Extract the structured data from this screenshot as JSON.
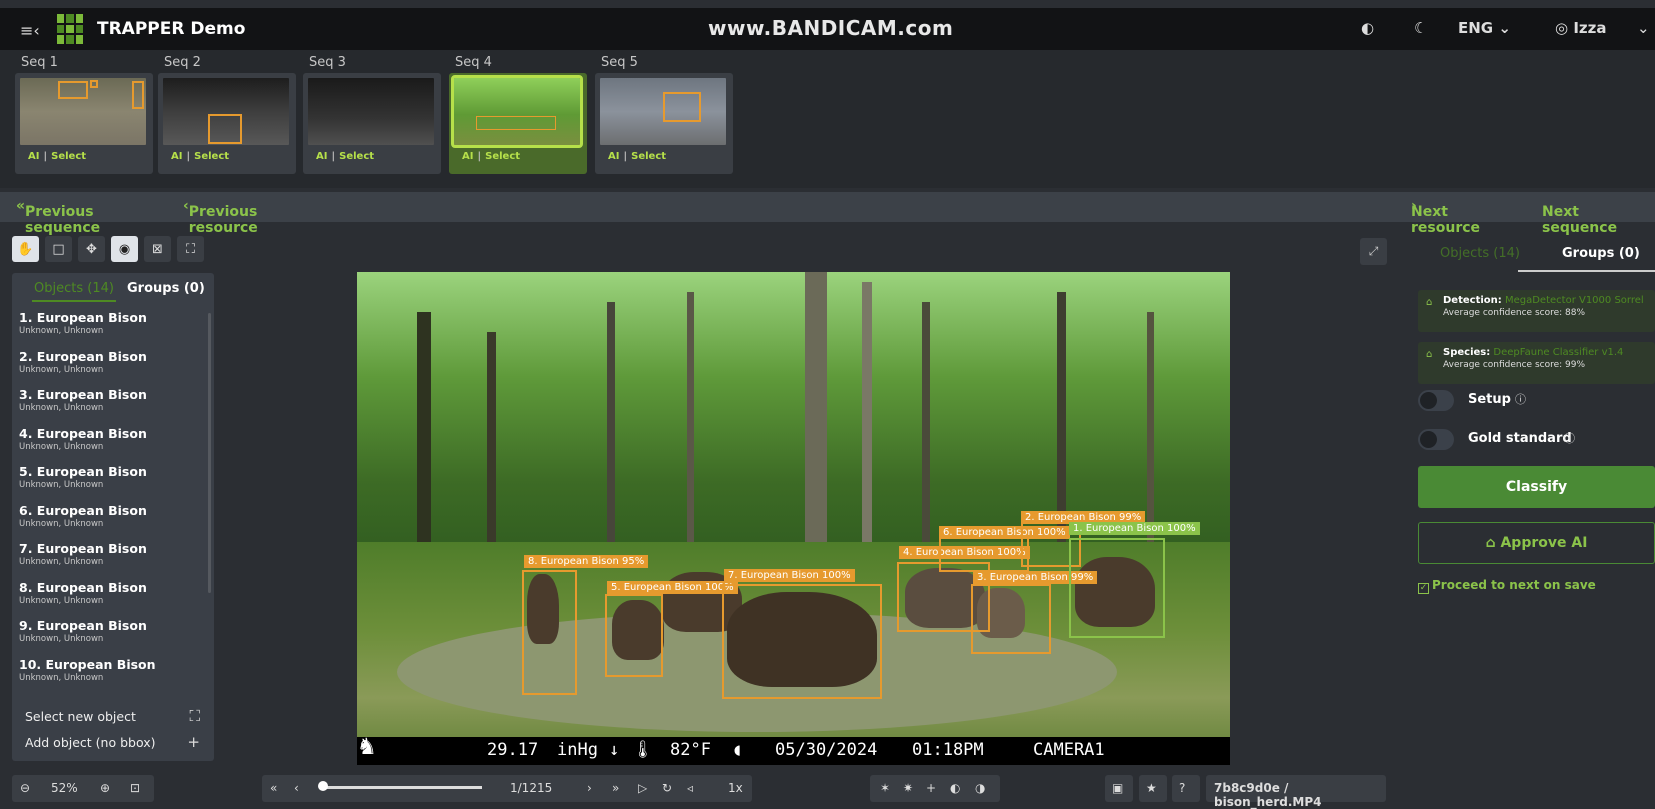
{
  "app": {
    "title": "TRAPPER Demo",
    "watermark": "www.BANDICAM.com"
  },
  "topbar": {
    "language": "ENG",
    "user": "Izza"
  },
  "sequences": [
    {
      "label": "Seq 1",
      "ai": "AI",
      "select": "Select",
      "active": false
    },
    {
      "label": "Seq 2",
      "ai": "AI",
      "select": "Select",
      "active": false
    },
    {
      "label": "Seq 3",
      "ai": "AI",
      "select": "Select",
      "active": false
    },
    {
      "label": "Seq 4",
      "ai": "AI",
      "select": "Select",
      "active": true
    },
    {
      "label": "Seq 5",
      "ai": "AI",
      "select": "Select",
      "active": false
    }
  ],
  "nav": {
    "prev_sequence": "Previous sequence",
    "prev_resource": "Previous resource",
    "next_resource": "Next resource",
    "next_sequence": "Next sequence"
  },
  "left_panel": {
    "tab_objects": "Objects (14)",
    "tab_groups": "Groups (0)",
    "objects": [
      {
        "name": "1. European Bison",
        "sub": "Unknown, Unknown"
      },
      {
        "name": "2. European Bison",
        "sub": "Unknown, Unknown"
      },
      {
        "name": "3. European Bison",
        "sub": "Unknown, Unknown"
      },
      {
        "name": "4. European Bison",
        "sub": "Unknown, Unknown"
      },
      {
        "name": "5. European Bison",
        "sub": "Unknown, Unknown"
      },
      {
        "name": "6. European Bison",
        "sub": "Unknown, Unknown"
      },
      {
        "name": "7. European Bison",
        "sub": "Unknown, Unknown"
      },
      {
        "name": "8. European Bison",
        "sub": "Unknown, Unknown"
      },
      {
        "name": "9. European Bison",
        "sub": "Unknown, Unknown"
      },
      {
        "name": "10. European Bison",
        "sub": "Unknown, Unknown"
      }
    ],
    "select_new_object": "Select new object",
    "add_object": "Add object (no bbox)"
  },
  "image": {
    "detections": [
      {
        "label": "8. European Bison",
        "conf": "95%"
      },
      {
        "label": "5. European Bison",
        "conf": "100%"
      },
      {
        "label": "7. European Bison",
        "conf": "100%"
      },
      {
        "label": "4. European Bison",
        "conf": "100%"
      },
      {
        "label": "3. European Bison",
        "conf": "99%"
      },
      {
        "label": "6. European Bison",
        "conf": "100%"
      },
      {
        "label": "2. European Bison",
        "conf": "99%"
      },
      {
        "label": "1. European Bison",
        "conf": "100%"
      }
    ],
    "overlay": {
      "pressure": "29.17",
      "pressure_unit": "inHg",
      "temp": "82°F",
      "date": "05/30/2024",
      "time": "01:18PM",
      "camera": "CAMERA1"
    }
  },
  "right_panel": {
    "tab_objects": "Objects (14)",
    "tab_groups": "Groups (0)",
    "detection_label": "Detection:",
    "detection_model": "MegaDetector V1000 Sorrel",
    "detection_score": "Average confidence score: 88%",
    "species_label": "Species:",
    "species_model": "DeepFaune Classifier v1.4",
    "species_score": "Average confidence score: 99%",
    "setup": "Setup",
    "gold_standard": "Gold standard",
    "classify": "Classify",
    "approve_ai": "Approve AI",
    "proceed": "Proceed to next on save"
  },
  "bottom": {
    "zoom": "52%",
    "frame": "1/1215",
    "speed": "1x",
    "filename": "7b8c9d0e / bison_herd.MP4",
    "progress": 0.0
  }
}
